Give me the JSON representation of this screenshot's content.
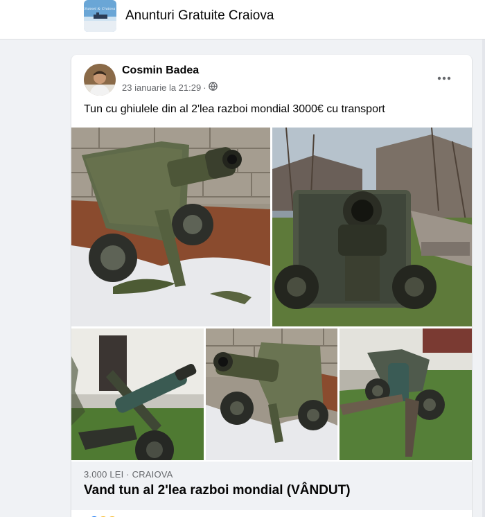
{
  "group": {
    "name": "Anunturi Gratuite Craiova",
    "thumbnail_icon": "group-cover-thumbnail"
  },
  "post": {
    "author": "Cosmin Badea",
    "date": "23 ianuarie la 21:29",
    "separator": "·",
    "privacy_icon": "globe-icon",
    "more_icon": "more-options-icon",
    "text": "Tun cu ghiulele din al 2'lea razboi mondial 3000€ cu transport",
    "photos": [
      "cannon-photo-1",
      "cannon-photo-2",
      "cannon-photo-3",
      "cannon-photo-4",
      "cannon-photo-5"
    ],
    "listing": {
      "price_location": "3.000 LEI · CRAIOVA",
      "title": "Vand tun al 2'lea razboi mondial (VÂNDUT)"
    }
  },
  "colors": {
    "page_bg": "#f0f2f5",
    "card_bg": "#ffffff",
    "text_primary": "#050505",
    "text_secondary": "#65676b"
  }
}
